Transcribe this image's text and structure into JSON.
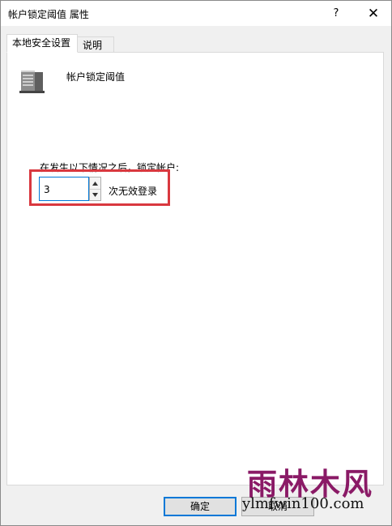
{
  "window": {
    "title": "帐户锁定阈值 属性",
    "help_button": "?",
    "close_button": "✕"
  },
  "tabs": [
    {
      "label": "本地安全设置",
      "active": true
    },
    {
      "label": "说明",
      "active": false
    }
  ],
  "policy": {
    "icon": "server-icon",
    "name": "帐户锁定阈值",
    "description": "在发生以下情况之后，锁定帐户:",
    "value": "3",
    "unit_label": "次无效登录"
  },
  "buttons": {
    "ok": "确定",
    "cancel": "取消"
  },
  "watermark": {
    "text_cn": "雨林木风",
    "text_en": "ylmfwin100.com",
    "color": "#8a1a66"
  },
  "colors": {
    "highlight_border": "#d9383f",
    "focus_blue": "#0078d7"
  }
}
